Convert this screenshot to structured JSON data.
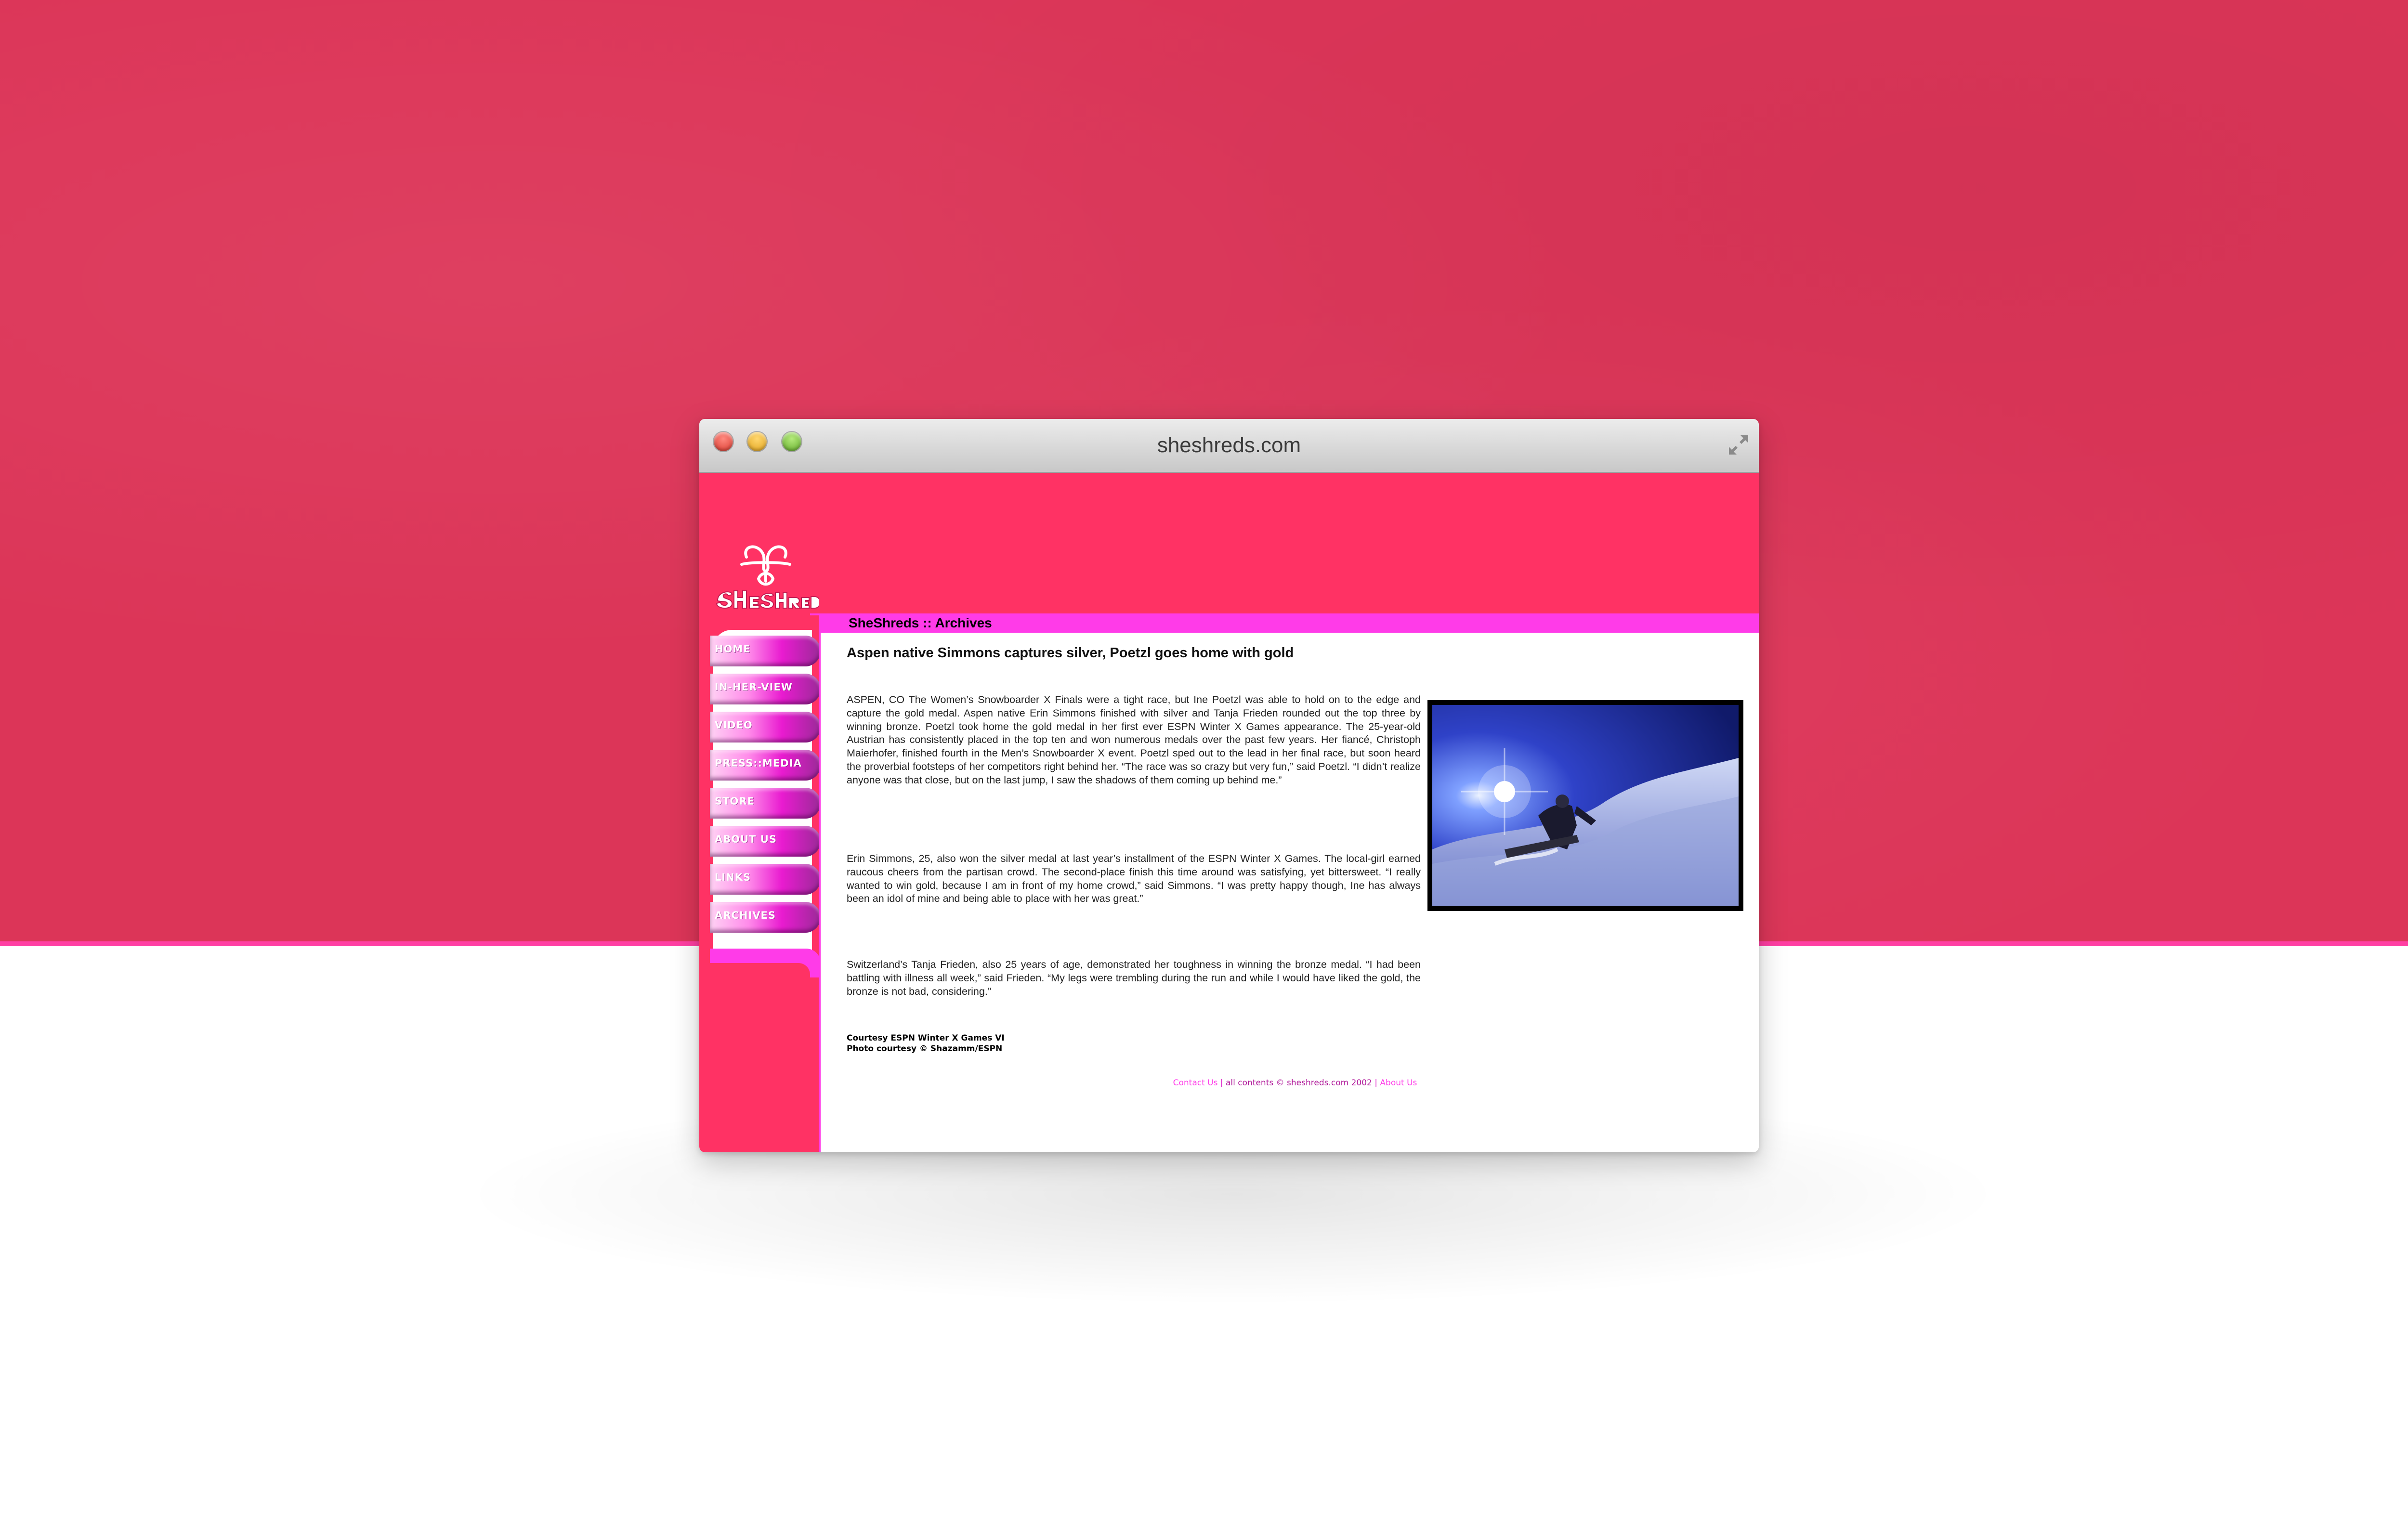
{
  "window": {
    "title": "sheshreds.com"
  },
  "site": {
    "logo_text": "SheShreds",
    "section_title": "SheShreds :: Archives"
  },
  "nav": {
    "items": [
      {
        "label": "HOME"
      },
      {
        "label": "IN-HER-VIEW"
      },
      {
        "label": "VIDEO"
      },
      {
        "label": "PRESS::MEDIA"
      },
      {
        "label": "STORE"
      },
      {
        "label": "ABOUT US"
      },
      {
        "label": "LINKS"
      },
      {
        "label": "ARCHIVES"
      }
    ]
  },
  "article": {
    "headline": "Aspen native Simmons captures silver, Poetzl goes home with gold",
    "paragraphs": [
      "ASPEN, CO The Women’s Snowboarder X Finals were a tight race, but Ine Poetzl was able to hold on to the edge and capture the gold medal. Aspen native Erin Simmons finished with silver and Tanja Frieden rounded out the top three by winning bronze. Poetzl took home the gold medal in her first ever ESPN Winter X Games appearance. The 25-year-old Austrian has consistently placed in the top ten and won numerous medals over the past few years. Her fiancé, Christoph Maierhofer, finished fourth in the Men’s Snowboarder X event. Poetzl sped out to the lead in her final race, but soon heard the proverbial footsteps of her competitors right behind her. “The race was so crazy but very fun,” said Poetzl. “I didn’t realize anyone was that close, but on the last jump, I saw the shadows of them coming up behind me.”",
      "Erin Simmons, 25, also won the silver medal at last year’s installment of the ESPN Winter X Games. The local-girl earned raucous cheers from the partisan crowd. The second-place finish this time around was satisfying, yet bittersweet. “I really wanted to win gold, because I am in front of my home crowd,” said Simmons. “I was pretty happy though, Ine has always been an idol of mine and being able to place with her was great.”",
      "Switzerland’s Tanja Frieden, also 25 years of age, demonstrated her toughness in winning the bronze medal. “I had been battling with illness all week,” said Frieden. “My legs were trembling during the run and while I would have liked the gold, the bronze is not bad, considering.”"
    ],
    "credits": [
      "Courtesy ESPN Winter X Games VI",
      "Photo courtesy © Shazamm/ESPN"
    ]
  },
  "footer": {
    "contact": "Contact Us",
    "separator": "|",
    "copyright": "all contents © sheshreds.com 2002",
    "about": "About Us"
  },
  "colors": {
    "background": "#dc3558",
    "header": "#ff3264",
    "accent": "#ff3be8",
    "nav_gradient_end": "#9b2a98"
  },
  "icons": {
    "window_controls": [
      "close-icon",
      "minimize-icon",
      "zoom-icon"
    ],
    "fullscreen": "fullscreen-arrows-icon"
  }
}
